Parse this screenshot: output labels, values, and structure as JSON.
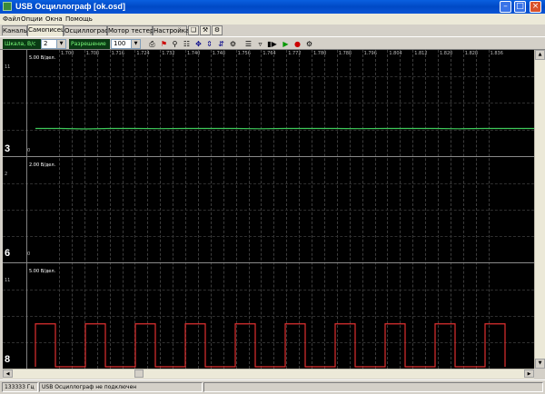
{
  "window": {
    "title": "USB Осциллограф [ok.osd]"
  },
  "menu": [
    "Файл",
    "Опции",
    "Окна",
    "Помощь"
  ],
  "tabs": [
    {
      "label": "Каналы"
    },
    {
      "label": "Самописец",
      "active": true
    },
    {
      "label": "Осциллограф"
    },
    {
      "label": "Мотор тестер"
    },
    {
      "label": "Настройка"
    }
  ],
  "toolbar": {
    "channel_label": "Шкала, В/с",
    "channel_value": "2",
    "resolution_label": "Разрешение",
    "resolution_value": "100"
  },
  "scope": {
    "time_ticks": [
      "1.700",
      "1.704",
      "1.708",
      "1.712",
      "1.716",
      "1.720",
      "1.724",
      "1.728",
      "1.732",
      "1.736",
      "1.740",
      "1.744",
      "1.748",
      "1.752",
      "1.756",
      "1.760",
      "1.764",
      "1.768",
      "1.772",
      "1.776",
      "1.780",
      "1.784",
      "1.788",
      "1.792",
      "1.796",
      "1.800",
      "1.804",
      "1.808",
      "1.812",
      "1.816",
      "1.820",
      "1.824",
      "1.828",
      "1.832",
      "1.836"
    ],
    "channels": [
      {
        "number": "3",
        "div_label": "5.00 В/дел.",
        "top_tick": "11",
        "bottom_tick": "0",
        "color": "#3ec85a"
      },
      {
        "number": "6",
        "div_label": "2.00 В/дел.",
        "top_tick": "2",
        "bottom_tick": "0",
        "color": "#e03030"
      },
      {
        "number": "8",
        "div_label": "5.00 В/дел.",
        "top_tick": "11",
        "bottom_tick": "0",
        "color": "#e03030"
      }
    ]
  },
  "chart_data": {
    "type": "line",
    "x_unit": "s",
    "xlim": [
      1.7,
      1.836
    ],
    "series": [
      {
        "name": "3",
        "y": [
          2.8,
          2.8,
          2.75,
          2.8,
          2.8,
          2.78,
          2.8,
          2.8,
          2.8,
          2.77,
          2.8,
          2.8,
          2.8,
          2.78,
          2.8,
          2.8,
          2.8,
          2.77,
          2.8,
          2.8,
          2.8
        ]
      },
      {
        "name": "8",
        "pulse_periods": 11,
        "duty": 0.4,
        "high": 5.2,
        "low": 0
      }
    ]
  },
  "status": {
    "frequency": "133333 Гц",
    "message": "USB Осциллограф не подключен"
  }
}
